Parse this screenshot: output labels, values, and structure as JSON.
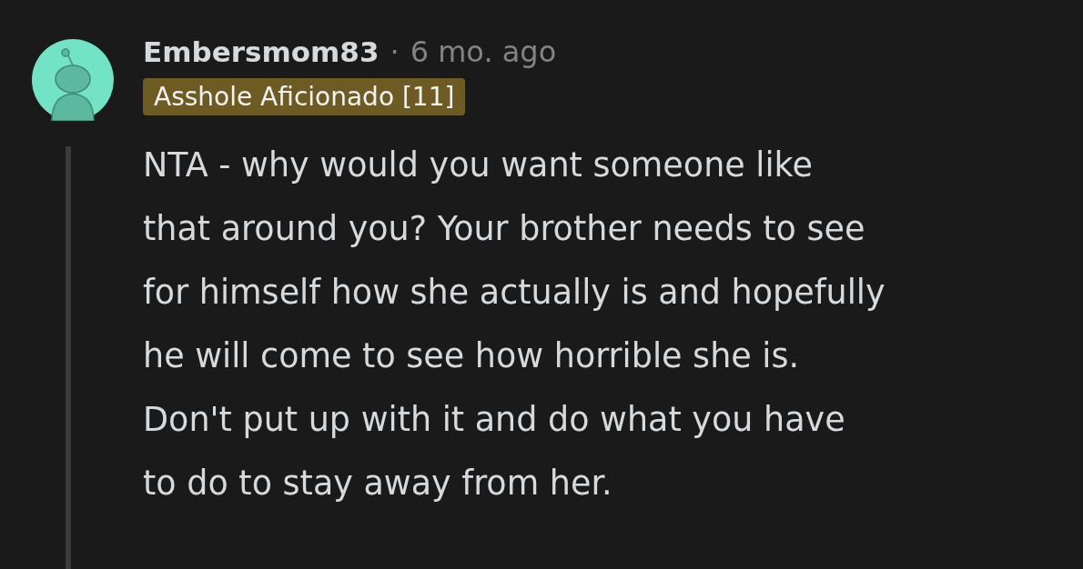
{
  "comment": {
    "author": "Embersmom83",
    "separator": "·",
    "age": "6 mo. ago",
    "flair": "Asshole Aficionado [11]",
    "body_lines": [
      "NTA - why would you want someone like",
      "that around you? Your brother needs to see",
      "for himself how she actually is and hopefully",
      "he will come to see how horrible she is.",
      "Don't put up with it and do what you have",
      "to do to stay away from her."
    ]
  }
}
